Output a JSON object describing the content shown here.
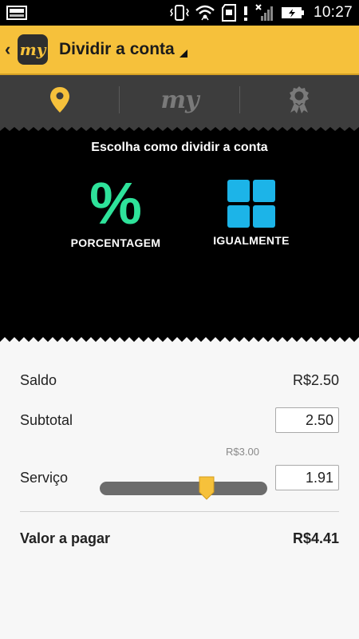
{
  "status": {
    "time": "10:27",
    "icons": [
      "image-notification-icon",
      "vibrate-icon",
      "wifi-icon",
      "sd-card-icon",
      "alert-icon",
      "signal-icon",
      "battery-charging-icon"
    ]
  },
  "app_bar": {
    "logo_text": "my",
    "title": "Dividir a conta"
  },
  "tabs": [
    {
      "name": "location-pin-icon",
      "active": true
    },
    {
      "name": "my-logo",
      "text": "my"
    },
    {
      "name": "award-badge-icon"
    }
  ],
  "panel": {
    "title": "Escolha como dividir a conta",
    "options": [
      {
        "label": "PORCENTAGEM",
        "icon": "percent-icon",
        "color": "#2ee29a"
      },
      {
        "label": "IGUALMENTE",
        "icon": "grid-icon",
        "color": "#1cb4e8"
      }
    ]
  },
  "summary": {
    "saldo_label": "Saldo",
    "saldo_value": "R$2.50",
    "subtotal_label": "Subtotal",
    "subtotal_value": "2.50",
    "servico_label": "Serviço",
    "servico_max": "R$3.00",
    "servico_value": "1.91",
    "servico_fraction": 0.637,
    "total_label": "Valor a pagar",
    "total_value": "R$4.41"
  },
  "colors": {
    "accent": "#f6c13b",
    "percent": "#2ee29a",
    "grid": "#1cb4e8"
  }
}
